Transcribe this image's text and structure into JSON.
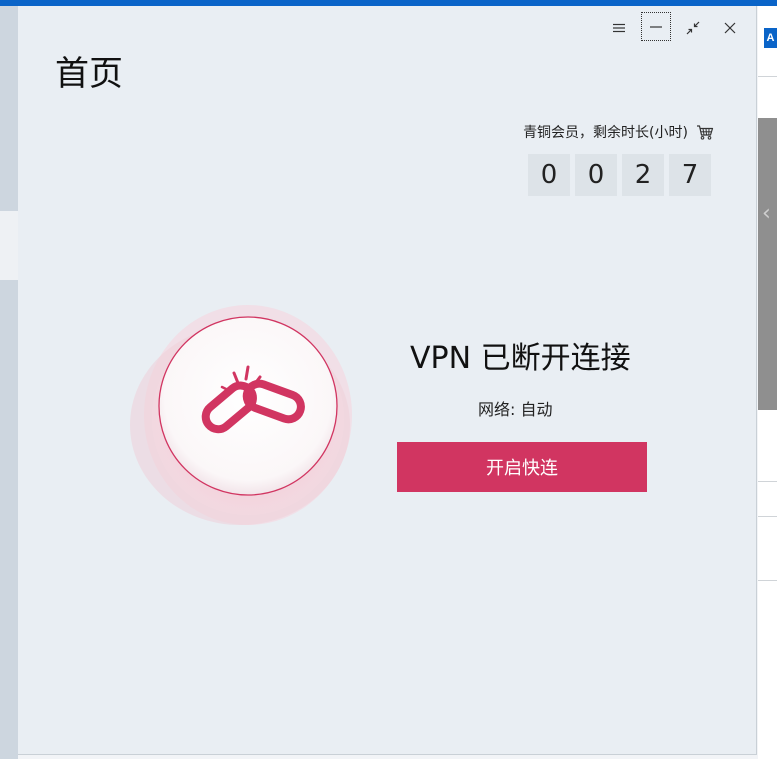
{
  "window": {
    "page_title": "首页",
    "controls": {
      "menu": "menu-icon",
      "minimize": "minimize-icon",
      "shrink": "shrink-icon",
      "close": "close-icon"
    }
  },
  "membership": {
    "label": "青铜会员，剩余时长(小时)",
    "icon": "cart-icon",
    "hours_digits": [
      "0",
      "0",
      "2",
      "7"
    ]
  },
  "status": {
    "icon": "broken-link-icon",
    "title": "VPN 已断开连接",
    "network": "网络: 自动",
    "connect_label": "开启快连"
  },
  "background": {
    "right_badge": "A"
  },
  "colors": {
    "accent": "#d13561",
    "window_bg": "#e9eef3",
    "digit_bg": "#dde3e8"
  }
}
